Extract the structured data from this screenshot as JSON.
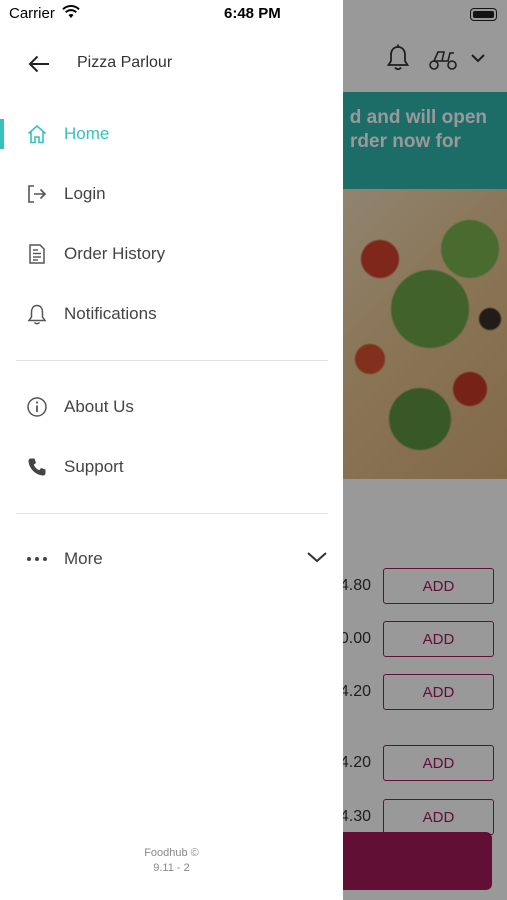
{
  "status_bar": {
    "carrier": "Carrier",
    "time": "6:48 PM"
  },
  "drawer": {
    "restaurant_name": "Pizza Parlour",
    "menu": {
      "home": "Home",
      "login": "Login",
      "order_history": "Order History",
      "notifications": "Notifications",
      "about_us": "About Us",
      "support": "Support",
      "more": "More"
    },
    "footer": {
      "brand": "Foodhub ©",
      "version": "9.11 - 2"
    }
  },
  "background": {
    "banner_line1": "d and will open",
    "banner_line2": "rder now for",
    "prices": [
      "4.80",
      "0.00",
      "4.20",
      "4.20",
      "4.30"
    ],
    "add_label": "ADD"
  },
  "colors": {
    "accent": "#35c2bb",
    "brand": "#a3195b",
    "banner": "#2fb5ae"
  }
}
